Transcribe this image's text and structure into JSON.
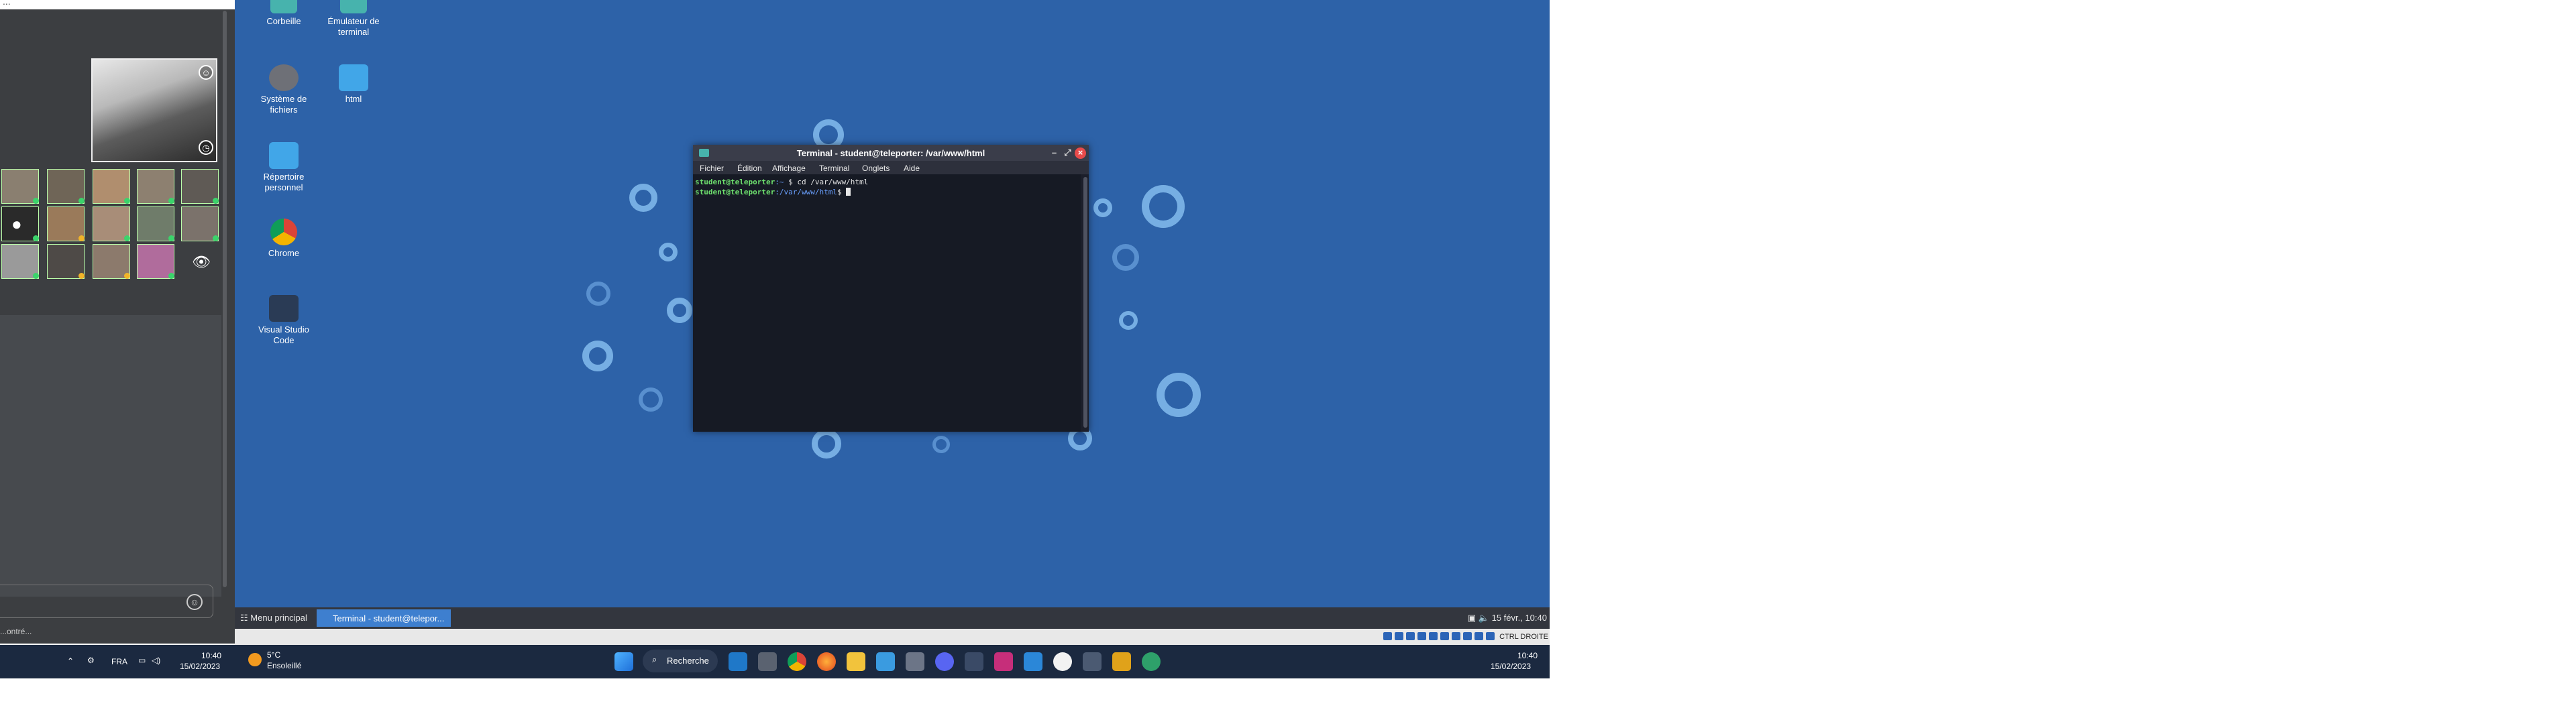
{
  "meeting": {
    "top_text": "...",
    "message_placeholder": "",
    "status_text": "...ontré..."
  },
  "desktop_icons": [
    {
      "label": "Corbeille",
      "icon": "trash-icon"
    },
    {
      "label": "Émulateur de terminal",
      "icon": "terminal-icon"
    },
    {
      "label": "Système de fichiers",
      "icon": "filesystem-icon"
    },
    {
      "label": "html",
      "icon": "folder-icon"
    },
    {
      "label": "Répertoire personnel",
      "icon": "home-folder-icon"
    },
    {
      "label": "Chrome",
      "icon": "chrome-icon"
    },
    {
      "label": "Visual Studio Code",
      "icon": "vscode-icon"
    }
  ],
  "terminal": {
    "title": "Terminal - student@teleporter: /var/www/html",
    "menu": [
      "Fichier",
      "Édition",
      "Affichage",
      "Terminal",
      "Onglets",
      "Aide"
    ],
    "line1_prompt": "student@teleporter",
    "line1_path": ":~",
    "line1_cmd": "$ cd /var/www/html",
    "line2_prompt": "student@teleporter",
    "line2_path": ":/var/www/html",
    "line2_cmd": "$ "
  },
  "linux_taskbar": {
    "menu_label": "Menu principal",
    "window_label": "Terminal - student@telepor...",
    "datetime": "15 févr., 10:40",
    "host_key": "CTRL DROITE"
  },
  "windows_taskbar": {
    "language": "FRA",
    "left_time": "10:40",
    "left_date": "15/02/2023",
    "weather_temp": "5°C",
    "weather_desc": "Ensoleillé",
    "search_label": "Recherche",
    "right_time": "10:40",
    "right_date": "15/02/2023",
    "pinned": [
      "start-icon",
      "search",
      "mail-icon",
      "calculator-icon",
      "chrome-icon",
      "firefox-icon",
      "explorer-icon",
      "notepad-icon",
      "camera-icon",
      "discord-icon",
      "steam-icon",
      "app-icon",
      "vscode-icon",
      "paint-icon",
      "teams-icon",
      "tools-icon",
      "globe-icon"
    ]
  },
  "colors": {
    "desktop_bg": "#2d62a8",
    "taskbar_win": "#1b2940",
    "terminal_bg": "#161a24",
    "prompt_green": "#6ee06e",
    "path_blue": "#6aa0ff"
  }
}
